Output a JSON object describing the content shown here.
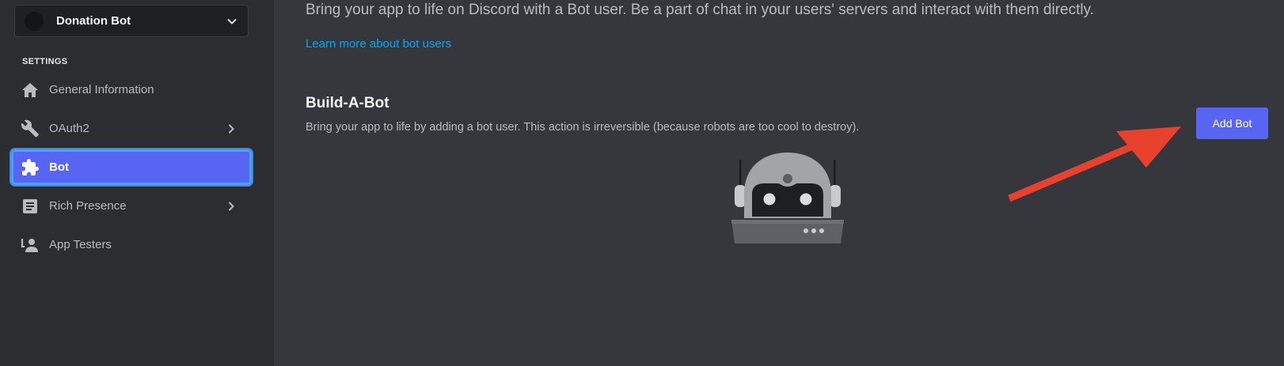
{
  "sidebar": {
    "app_name": "Donation Bot",
    "section_title": "SETTINGS",
    "items": [
      {
        "label": "General Information",
        "icon": "home-icon"
      },
      {
        "label": "OAuth2",
        "icon": "wrench-icon",
        "has_chevron": true
      },
      {
        "label": "Bot",
        "icon": "puzzle-icon",
        "active": true
      },
      {
        "label": "Rich Presence",
        "icon": "document-icon",
        "has_chevron": true
      },
      {
        "label": "App Testers",
        "icon": "person-icon"
      }
    ]
  },
  "main": {
    "intro": "Bring your app to life on Discord with a Bot user. Be a part of chat in your users' servers and interact with them directly.",
    "learn_more_link": "Learn more about bot users",
    "section_heading": "Build-A-Bot",
    "section_desc": "Bring your app to life by adding a bot user. This action is irreversible (because robots are too cool to destroy).",
    "add_bot_label": "Add Bot"
  },
  "colors": {
    "accent": "#5865f2",
    "link": "#00a8fc",
    "annotation_arrow": "#e8412d",
    "sidebar_bg": "#2b2d31",
    "main_bg": "#36373d"
  }
}
